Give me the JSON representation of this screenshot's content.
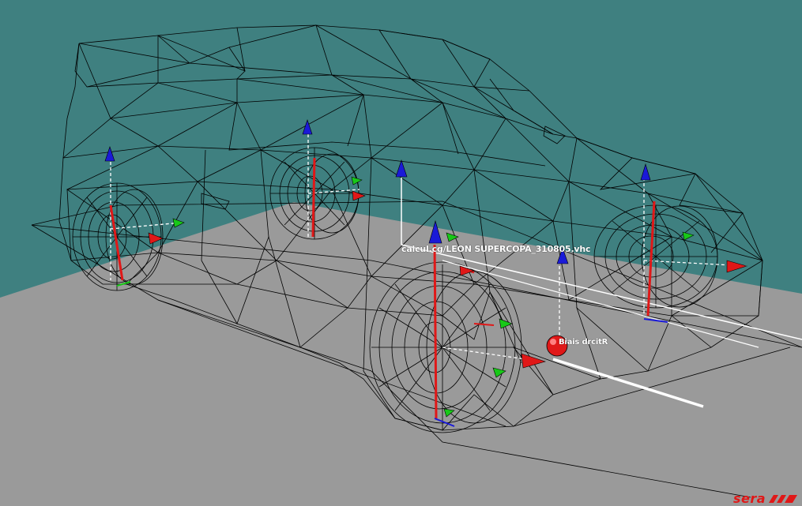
{
  "scene": {
    "model_file": "calcul.cg/LEON SUPERCOPA_310805.vhc",
    "node_label": "Biais drcitR",
    "logo": "sera"
  },
  "colors": {
    "background": "#3f8080",
    "ground": "#9a9a9a",
    "wire": "#000000",
    "axis_x": "#e01818",
    "axis_y": "#18c818",
    "axis_z": "#1a1ad8",
    "guide": "#ffffff",
    "logo": "#e01818"
  }
}
